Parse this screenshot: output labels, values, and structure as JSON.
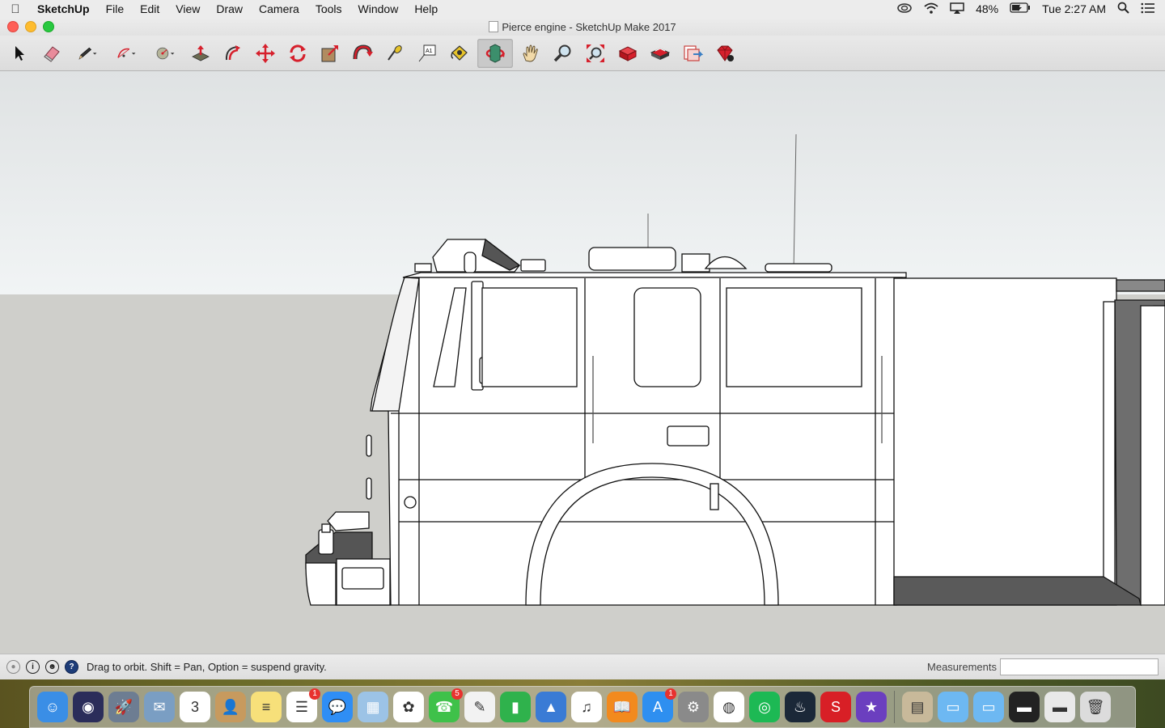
{
  "menubar": {
    "app_name": "SketchUp",
    "items": [
      "File",
      "Edit",
      "View",
      "Draw",
      "Camera",
      "Tools",
      "Window",
      "Help"
    ],
    "battery": "48%",
    "clock": "Tue 2:27 AM"
  },
  "window": {
    "title": "Pierce engine - SketchUp Make 2017"
  },
  "toolbar": {
    "tools": [
      {
        "name": "select-tool",
        "icon": "arrow-icon"
      },
      {
        "name": "eraser-tool",
        "icon": "eraser-icon"
      },
      {
        "name": "line-tool",
        "icon": "pencil-icon"
      },
      {
        "name": "arc-tool",
        "icon": "arc-icon"
      },
      {
        "name": "shape-tool",
        "icon": "circle-icon"
      },
      {
        "name": "push-pull-tool",
        "icon": "push-pull-icon"
      },
      {
        "name": "offset-tool",
        "icon": "offset-icon"
      },
      {
        "name": "move-tool",
        "icon": "move-icon"
      },
      {
        "name": "rotate-tool",
        "icon": "rotate-icon"
      },
      {
        "name": "scale-tool",
        "icon": "scale-icon"
      },
      {
        "name": "follow-me-tool",
        "icon": "follow-me-icon"
      },
      {
        "name": "tape-measure-tool",
        "icon": "tape-measure-icon"
      },
      {
        "name": "text-tool",
        "icon": "text-icon"
      },
      {
        "name": "paint-bucket-tool",
        "icon": "paint-bucket-icon"
      },
      {
        "name": "orbit-tool",
        "icon": "orbit-icon"
      },
      {
        "name": "pan-tool",
        "icon": "hand-icon"
      },
      {
        "name": "zoom-tool",
        "icon": "magnifier-icon"
      },
      {
        "name": "zoom-extents-tool",
        "icon": "zoom-extents-icon"
      },
      {
        "name": "3d-warehouse-button",
        "icon": "warehouse-icon"
      },
      {
        "name": "extension-warehouse-button",
        "icon": "extension-icon"
      },
      {
        "name": "send-to-layout-button",
        "icon": "layout-icon"
      },
      {
        "name": "extension-manager-button",
        "icon": "ruby-icon"
      }
    ],
    "active_tool": "orbit-tool",
    "text_tool_label": "A1"
  },
  "statusbar": {
    "message": "Drag to orbit. Shift = Pan, Option = suspend gravity.",
    "measurements_label": "Measurements",
    "measurements_value": ""
  },
  "viewport": {
    "sky_color": "#eaeeef",
    "ground_color": "#cfcfcb",
    "model": "fire-engine-model"
  },
  "dock": {
    "apps": [
      {
        "name": "finder",
        "color": "#3a8ee6",
        "glyph": "☺"
      },
      {
        "name": "siri",
        "color": "#2b2d5a",
        "glyph": "◉"
      },
      {
        "name": "launchpad",
        "color": "#6d7d92",
        "glyph": "🚀"
      },
      {
        "name": "mail-bird",
        "color": "#7a9ec3",
        "glyph": "✉"
      },
      {
        "name": "calendar",
        "color": "#ffffff",
        "glyph": "3"
      },
      {
        "name": "contacts",
        "color": "#c79a5e",
        "glyph": "👤"
      },
      {
        "name": "notes",
        "color": "#f7e07a",
        "glyph": "≡"
      },
      {
        "name": "reminders",
        "color": "#ffffff",
        "glyph": "☰",
        "badge": "1"
      },
      {
        "name": "messages-bubble",
        "color": "#2f8ef5",
        "glyph": "💬"
      },
      {
        "name": "preview",
        "color": "#9cc3e6",
        "glyph": "▦"
      },
      {
        "name": "photos",
        "color": "#ffffff",
        "glyph": "✿"
      },
      {
        "name": "facetime",
        "color": "#3fc14a",
        "glyph": "☎",
        "badge": "5"
      },
      {
        "name": "textedit",
        "color": "#f2f2f2",
        "glyph": "✎"
      },
      {
        "name": "numbers",
        "color": "#2fb24c",
        "glyph": "▮"
      },
      {
        "name": "keynote",
        "color": "#3a7bd5",
        "glyph": "▲"
      },
      {
        "name": "itunes",
        "color": "#ffffff",
        "glyph": "♫"
      },
      {
        "name": "ibooks",
        "color": "#f28a1e",
        "glyph": "📖"
      },
      {
        "name": "app-store",
        "color": "#2e8ff0",
        "glyph": "A",
        "badge": "1"
      },
      {
        "name": "system-preferences",
        "color": "#8a8a8a",
        "glyph": "⚙"
      },
      {
        "name": "chrome",
        "color": "#ffffff",
        "glyph": "◍"
      },
      {
        "name": "spotify",
        "color": "#1db954",
        "glyph": "◎"
      },
      {
        "name": "steam",
        "color": "#1b2838",
        "glyph": "♨"
      },
      {
        "name": "sketchup",
        "color": "#d81f26",
        "glyph": "S"
      },
      {
        "name": "imovie",
        "color": "#6b3fbf",
        "glyph": "★"
      }
    ],
    "folders": [
      {
        "name": "documents-stack",
        "color": "#c8b99a",
        "glyph": "▤"
      },
      {
        "name": "folder-1",
        "color": "#6db8f2",
        "glyph": "▭"
      },
      {
        "name": "folder-2",
        "color": "#6db8f2",
        "glyph": "▭"
      },
      {
        "name": "spotify-window",
        "color": "#222222",
        "glyph": "▬"
      },
      {
        "name": "chrome-window",
        "color": "#e9e9e9",
        "glyph": "▬"
      },
      {
        "name": "trash",
        "color": "#dcdcdc",
        "glyph": "🗑"
      }
    ]
  }
}
